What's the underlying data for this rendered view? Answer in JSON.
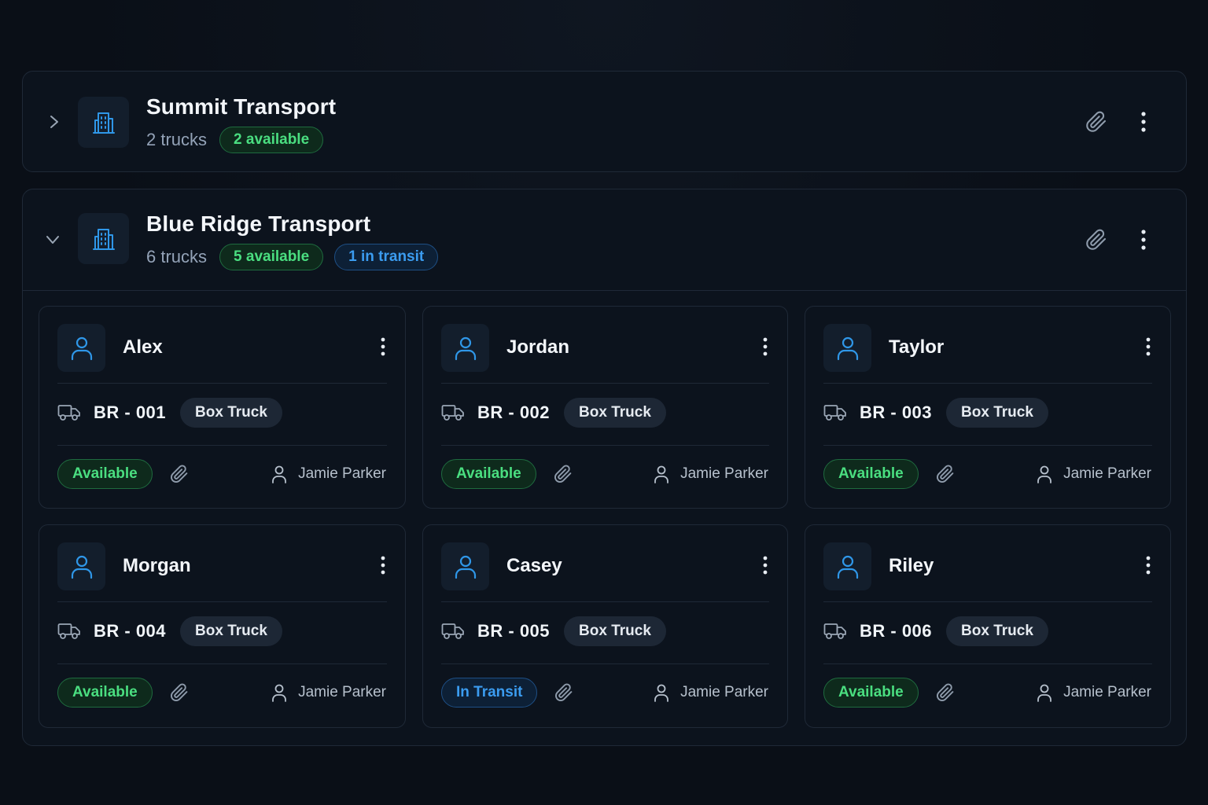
{
  "groups": [
    {
      "title": "Summit Transport",
      "count": "2 trucks",
      "badges": [
        {
          "label": "2 available",
          "tone": "green"
        }
      ],
      "expanded": false
    },
    {
      "title": "Blue Ridge Transport",
      "count": "6 trucks",
      "badges": [
        {
          "label": "5 available",
          "tone": "green"
        },
        {
          "label": "1 in transit",
          "tone": "blue"
        }
      ],
      "expanded": true,
      "drivers": [
        {
          "name": "Alex",
          "truck_id": "BR - 001",
          "truck_type": "Box Truck",
          "status": "Available",
          "owner": "Jamie Parker"
        },
        {
          "name": "Jordan",
          "truck_id": "BR - 002",
          "truck_type": "Box Truck",
          "status": "Available",
          "owner": "Jamie Parker"
        },
        {
          "name": "Taylor",
          "truck_id": "BR - 003",
          "truck_type": "Box Truck",
          "status": "Available",
          "owner": "Jamie Parker"
        },
        {
          "name": "Morgan",
          "truck_id": "BR - 004",
          "truck_type": "Box Truck",
          "status": "Available",
          "owner": "Jamie Parker"
        },
        {
          "name": "Casey",
          "truck_id": "BR - 005",
          "truck_type": "Box Truck",
          "status": "In Transit",
          "owner": "Jamie Parker"
        },
        {
          "name": "Riley",
          "truck_id": "BR - 006",
          "truck_type": "Box Truck",
          "status": "Available",
          "owner": "Jamie Parker"
        }
      ]
    }
  ],
  "colors": {
    "background": "#0a0f17",
    "panel": "#0c131d",
    "border": "#1f2937",
    "accent_blue": "#3b9cf0",
    "status_green": "#4ade80"
  },
  "icons": {
    "collapse": "chevron-right-icon",
    "expand": "chevron-down-icon",
    "company": "building-icon",
    "attach": "paperclip-icon",
    "menu": "kebab-icon",
    "driver": "user-icon",
    "truck": "truck-icon"
  }
}
